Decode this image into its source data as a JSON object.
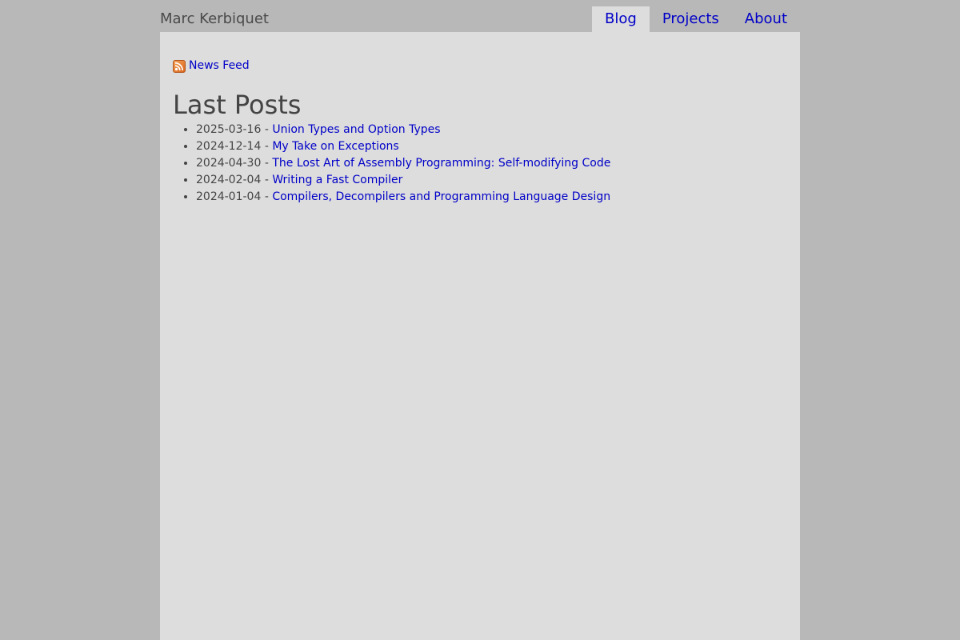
{
  "site": {
    "title": "Marc Kerbiquet"
  },
  "nav": {
    "items": [
      {
        "label": "Blog",
        "active": true
      },
      {
        "label": "Projects",
        "active": false
      },
      {
        "label": "About",
        "active": false
      }
    ]
  },
  "feed": {
    "label": "News Feed",
    "icon": "rss-icon"
  },
  "main": {
    "heading": "Last Posts",
    "separator": " - ",
    "posts": [
      {
        "date": "2025-03-16",
        "title": "Union Types and Option Types"
      },
      {
        "date": "2024-12-14",
        "title": "My Take on Exceptions"
      },
      {
        "date": "2024-04-30",
        "title": "The Lost Art of Assembly Programming: Self-modifying Code"
      },
      {
        "date": "2024-02-04",
        "title": "Writing a Fast Compiler"
      },
      {
        "date": "2024-01-04",
        "title": "Compilers, Decompilers and Programming Language Design"
      }
    ]
  },
  "colors": {
    "link": "#0000c8",
    "page_background": "#b8b8b8",
    "content_background": "#dddddd",
    "rss_orange": "#e8782a"
  }
}
